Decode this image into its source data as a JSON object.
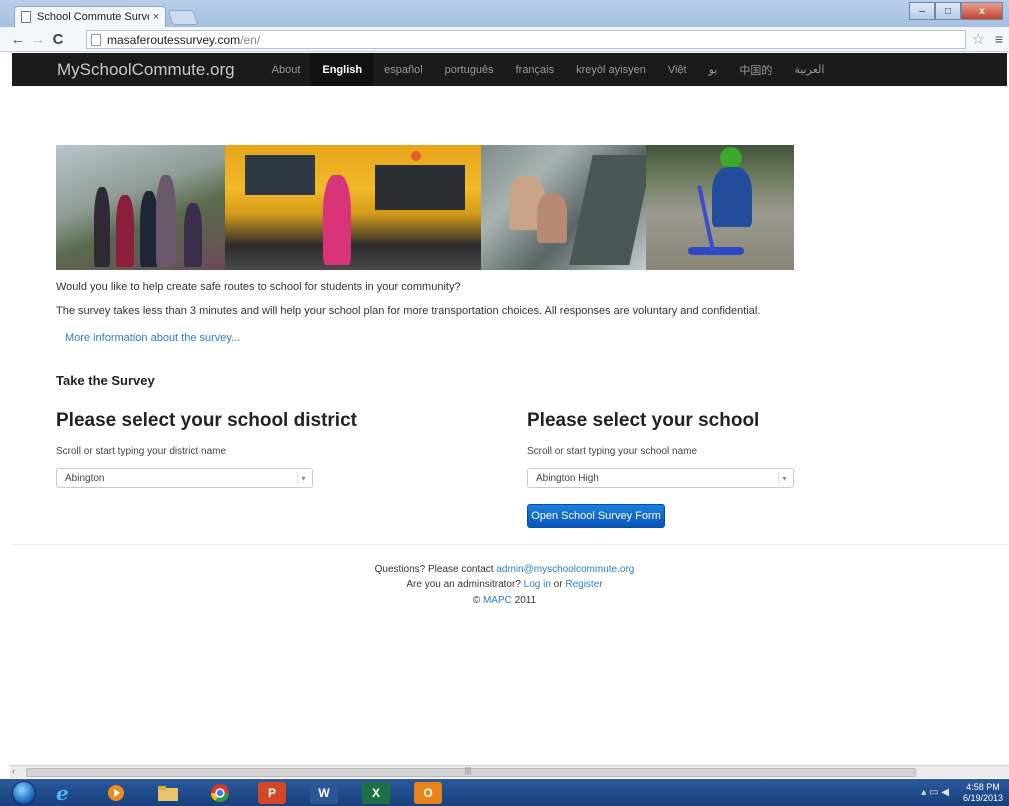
{
  "browser": {
    "tab_title": "School Commute Survey",
    "tab_close": "×",
    "url_host": "masaferoutessurvey.com",
    "url_path": "/en/",
    "back": "←",
    "forward": "→",
    "reload": "C",
    "star": "☆",
    "menu": "≡",
    "minimize": "–",
    "maximize": "□",
    "close": "x"
  },
  "sitenav": {
    "brand": "MySchoolCommute.org",
    "links": [
      "About",
      "English",
      "español",
      "português",
      "français",
      "kreyòl ayisyen",
      "Việt",
      "یو",
      "中国的",
      "العربية"
    ]
  },
  "content": {
    "intro1": "Would you like to help create safe routes to school for students in your community?",
    "intro2": "The survey takes less than 3 minutes and will help your school plan for more transportation choices. All responses are voluntary and confidential.",
    "more_info": "More information about the survey...",
    "take_survey": "Take the Survey",
    "district": {
      "title": "Please select your school district",
      "hint": "Scroll or start typing your district name",
      "value": "Abington"
    },
    "school": {
      "title": "Please select your school",
      "hint": "Scroll or start typing your school name",
      "value": "Abington High"
    },
    "open_button": "Open School Survey Form",
    "select_caret": "▾"
  },
  "footer": {
    "questions": "Questions? Please contact ",
    "email": "admin@myschoolcommute.org",
    "admin_q": "Are you an adminsitrator? ",
    "login": "Log in",
    "or": " or ",
    "register": "Register",
    "copyright_sym": "© ",
    "mapc": "MAPC",
    "year": " 2011"
  },
  "scrollbar": {
    "left_arrow": "‹",
    "grip": "|||"
  },
  "taskbar": {
    "icons": [
      "ie-icon",
      "media-player-icon",
      "file-explorer-icon",
      "chrome-icon",
      "powerpoint-icon",
      "word-icon",
      "excel-icon",
      "outlook-icon"
    ],
    "powerpoint_letter": "P",
    "word_letter": "W",
    "excel_letter": "X",
    "outlook_letter": "O",
    "tray_icons": "▴  ▭  ◀",
    "time": "4:58 PM",
    "date": "6/19/2013"
  },
  "colors": {
    "nav_bg": "#1b1b1b",
    "link": "#2a7fc0",
    "button": "#0a57b8"
  }
}
